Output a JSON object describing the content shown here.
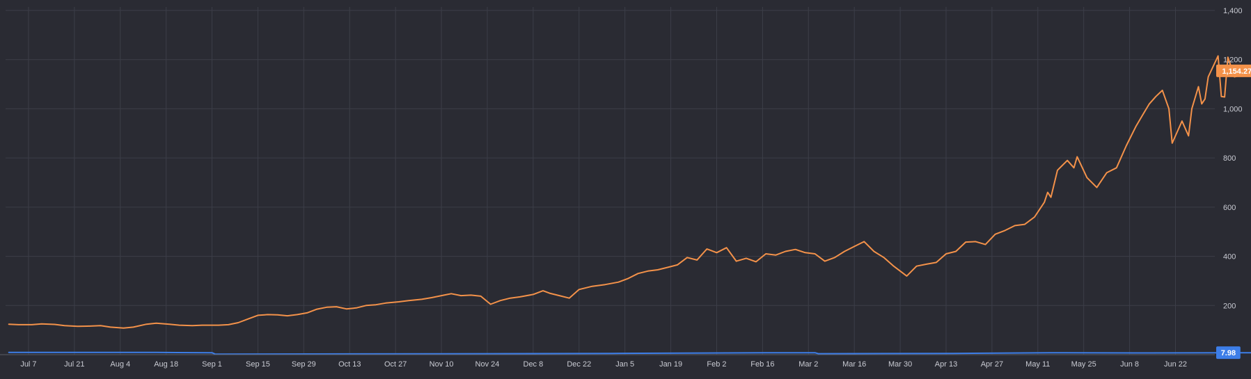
{
  "colors": {
    "background": "#2a2b33",
    "grid": "#3c3e48",
    "tick_text": "#c9cbd3",
    "series_orange": "#f4924a",
    "series_blue": "#3d7ee8"
  },
  "chart_data": {
    "type": "line",
    "title": "",
    "xlabel": "",
    "ylabel": "",
    "y_axis_side": "right",
    "ylim": [
      0,
      1400
    ],
    "yticks": [
      "200",
      "400",
      "600",
      "800",
      "1,000",
      "1,200",
      "1,400"
    ],
    "ytick_values": [
      200,
      400,
      600,
      800,
      1000,
      1200,
      1400
    ],
    "xlim": [
      "2024-06-30",
      "2025-07-04"
    ],
    "xtick_labels": [
      "Jul 7",
      "Jul 21",
      "Aug 4",
      "Aug 18",
      "Sep 1",
      "Sep 15",
      "Sep 29",
      "Oct 13",
      "Oct 27",
      "Nov 10",
      "Nov 24",
      "Dec 8",
      "Dec 22",
      "Jan 5",
      "Jan 19",
      "Feb 2",
      "Feb 16",
      "Mar 2",
      "Mar 16",
      "Mar 30",
      "Apr 13",
      "Apr 27",
      "May 11",
      "May 25",
      "Jun 8",
      "Jun 22"
    ],
    "xtick_dates": [
      "2024-07-07",
      "2024-07-21",
      "2024-08-04",
      "2024-08-18",
      "2024-09-01",
      "2024-09-15",
      "2024-09-29",
      "2024-10-13",
      "2024-10-27",
      "2024-11-10",
      "2024-11-24",
      "2024-12-08",
      "2024-12-22",
      "2025-01-05",
      "2025-01-19",
      "2025-02-02",
      "2025-02-16",
      "2025-03-02",
      "2025-03-16",
      "2025-03-30",
      "2025-04-13",
      "2025-04-27",
      "2025-05-11",
      "2025-05-25",
      "2025-06-08",
      "2025-06-22"
    ],
    "grid": true,
    "legend": "none",
    "series": [
      {
        "color": "#f4924a",
        "last_value_label": "1,154.27",
        "points": [
          [
            "2024-07-01",
            124
          ],
          [
            "2024-07-04",
            122
          ],
          [
            "2024-07-08",
            122
          ],
          [
            "2024-07-11",
            125
          ],
          [
            "2024-07-15",
            123
          ],
          [
            "2024-07-18",
            118
          ],
          [
            "2024-07-22",
            115
          ],
          [
            "2024-07-25",
            116
          ],
          [
            "2024-07-29",
            118
          ],
          [
            "2024-08-01",
            112
          ],
          [
            "2024-08-05",
            108
          ],
          [
            "2024-08-08",
            112
          ],
          [
            "2024-08-12",
            124
          ],
          [
            "2024-08-15",
            128
          ],
          [
            "2024-08-19",
            124
          ],
          [
            "2024-08-22",
            120
          ],
          [
            "2024-08-26",
            118
          ],
          [
            "2024-08-29",
            120
          ],
          [
            "2024-09-03",
            120
          ],
          [
            "2024-09-06",
            122
          ],
          [
            "2024-09-09",
            130
          ],
          [
            "2024-09-12",
            145
          ],
          [
            "2024-09-15",
            160
          ],
          [
            "2024-09-18",
            163
          ],
          [
            "2024-09-21",
            162
          ],
          [
            "2024-09-24",
            158
          ],
          [
            "2024-09-27",
            163
          ],
          [
            "2024-09-30",
            170
          ],
          [
            "2024-10-03",
            185
          ],
          [
            "2024-10-06",
            193
          ],
          [
            "2024-10-09",
            195
          ],
          [
            "2024-10-12",
            186
          ],
          [
            "2024-10-15",
            190
          ],
          [
            "2024-10-18",
            200
          ],
          [
            "2024-10-21",
            203
          ],
          [
            "2024-10-24",
            210
          ],
          [
            "2024-10-28",
            215
          ],
          [
            "2024-10-31",
            220
          ],
          [
            "2024-11-04",
            225
          ],
          [
            "2024-11-07",
            232
          ],
          [
            "2024-11-10",
            240
          ],
          [
            "2024-11-13",
            248
          ],
          [
            "2024-11-16",
            240
          ],
          [
            "2024-11-19",
            242
          ],
          [
            "2024-11-22",
            238
          ],
          [
            "2024-11-25",
            205
          ],
          [
            "2024-11-28",
            220
          ],
          [
            "2024-12-01",
            230
          ],
          [
            "2024-12-04",
            235
          ],
          [
            "2024-12-08",
            245
          ],
          [
            "2024-12-11",
            260
          ],
          [
            "2024-12-13",
            250
          ],
          [
            "2024-12-16",
            240
          ],
          [
            "2024-12-19",
            230
          ],
          [
            "2024-12-22",
            265
          ],
          [
            "2024-12-26",
            278
          ],
          [
            "2024-12-30",
            285
          ],
          [
            "2025-01-03",
            295
          ],
          [
            "2025-01-06",
            310
          ],
          [
            "2025-01-09",
            330
          ],
          [
            "2025-01-12",
            340
          ],
          [
            "2025-01-15",
            345
          ],
          [
            "2025-01-18",
            355
          ],
          [
            "2025-01-21",
            365
          ],
          [
            "2025-01-24",
            395
          ],
          [
            "2025-01-27",
            385
          ],
          [
            "2025-01-30",
            430
          ],
          [
            "2025-02-02",
            415
          ],
          [
            "2025-02-05",
            435
          ],
          [
            "2025-02-08",
            380
          ],
          [
            "2025-02-11",
            392
          ],
          [
            "2025-02-14",
            378
          ],
          [
            "2025-02-17",
            410
          ],
          [
            "2025-02-20",
            405
          ],
          [
            "2025-02-23",
            420
          ],
          [
            "2025-02-26",
            428
          ],
          [
            "2025-03-01",
            415
          ],
          [
            "2025-03-04",
            410
          ],
          [
            "2025-03-07",
            380
          ],
          [
            "2025-03-10",
            395
          ],
          [
            "2025-03-13",
            420
          ],
          [
            "2025-03-16",
            440
          ],
          [
            "2025-03-19",
            460
          ],
          [
            "2025-03-22",
            420
          ],
          [
            "2025-03-25",
            395
          ],
          [
            "2025-03-28",
            360
          ],
          [
            "2025-04-01",
            320
          ],
          [
            "2025-04-04",
            360
          ],
          [
            "2025-04-07",
            368
          ],
          [
            "2025-04-10",
            375
          ],
          [
            "2025-04-13",
            410
          ],
          [
            "2025-04-16",
            420
          ],
          [
            "2025-04-19",
            458
          ],
          [
            "2025-04-22",
            460
          ],
          [
            "2025-04-25",
            448
          ],
          [
            "2025-04-28",
            490
          ],
          [
            "2025-05-01",
            505
          ],
          [
            "2025-05-04",
            525
          ],
          [
            "2025-05-07",
            530
          ],
          [
            "2025-05-10",
            560
          ],
          [
            "2025-05-13",
            620
          ],
          [
            "2025-05-14",
            660
          ],
          [
            "2025-05-15",
            640
          ],
          [
            "2025-05-17",
            750
          ],
          [
            "2025-05-20",
            790
          ],
          [
            "2025-05-22",
            760
          ],
          [
            "2025-05-23",
            805
          ],
          [
            "2025-05-26",
            720
          ],
          [
            "2025-05-29",
            680
          ],
          [
            "2025-06-01",
            740
          ],
          [
            "2025-06-04",
            760
          ],
          [
            "2025-06-07",
            850
          ],
          [
            "2025-06-10",
            930
          ],
          [
            "2025-06-12",
            975
          ],
          [
            "2025-06-14",
            1020
          ],
          [
            "2025-06-16",
            1050
          ],
          [
            "2025-06-18",
            1075
          ],
          [
            "2025-06-20",
            1000
          ],
          [
            "2025-06-21",
            860
          ],
          [
            "2025-06-24",
            950
          ],
          [
            "2025-06-26",
            890
          ],
          [
            "2025-06-27",
            1000
          ],
          [
            "2025-06-29",
            1090
          ],
          [
            "2025-06-30",
            1020
          ],
          [
            "2025-07-01",
            1040
          ],
          [
            "2025-07-02",
            1130
          ],
          [
            "2025-07-05",
            1215
          ],
          [
            "2025-07-06",
            1050
          ],
          [
            "2025-07-07",
            1048
          ],
          [
            "2025-07-08",
            1210
          ],
          [
            "2025-07-10",
            1130
          ],
          [
            "2025-07-13",
            1140
          ],
          [
            "2025-07-15",
            1154.27
          ]
        ]
      },
      {
        "color": "#3d7ee8",
        "last_value_label": "7.98",
        "points": [
          [
            "2024-07-01",
            9
          ],
          [
            "2024-08-15",
            9
          ],
          [
            "2024-09-01",
            8
          ],
          [
            "2024-09-02",
            2
          ],
          [
            "2024-10-15",
            3
          ],
          [
            "2024-11-25",
            4
          ],
          [
            "2025-01-01",
            5
          ],
          [
            "2025-02-17",
            8
          ],
          [
            "2025-03-04",
            8
          ],
          [
            "2025-03-05",
            4
          ],
          [
            "2025-04-15",
            5
          ],
          [
            "2025-05-15",
            8
          ],
          [
            "2025-06-10",
            7
          ],
          [
            "2025-07-15",
            7.98
          ]
        ]
      }
    ]
  }
}
